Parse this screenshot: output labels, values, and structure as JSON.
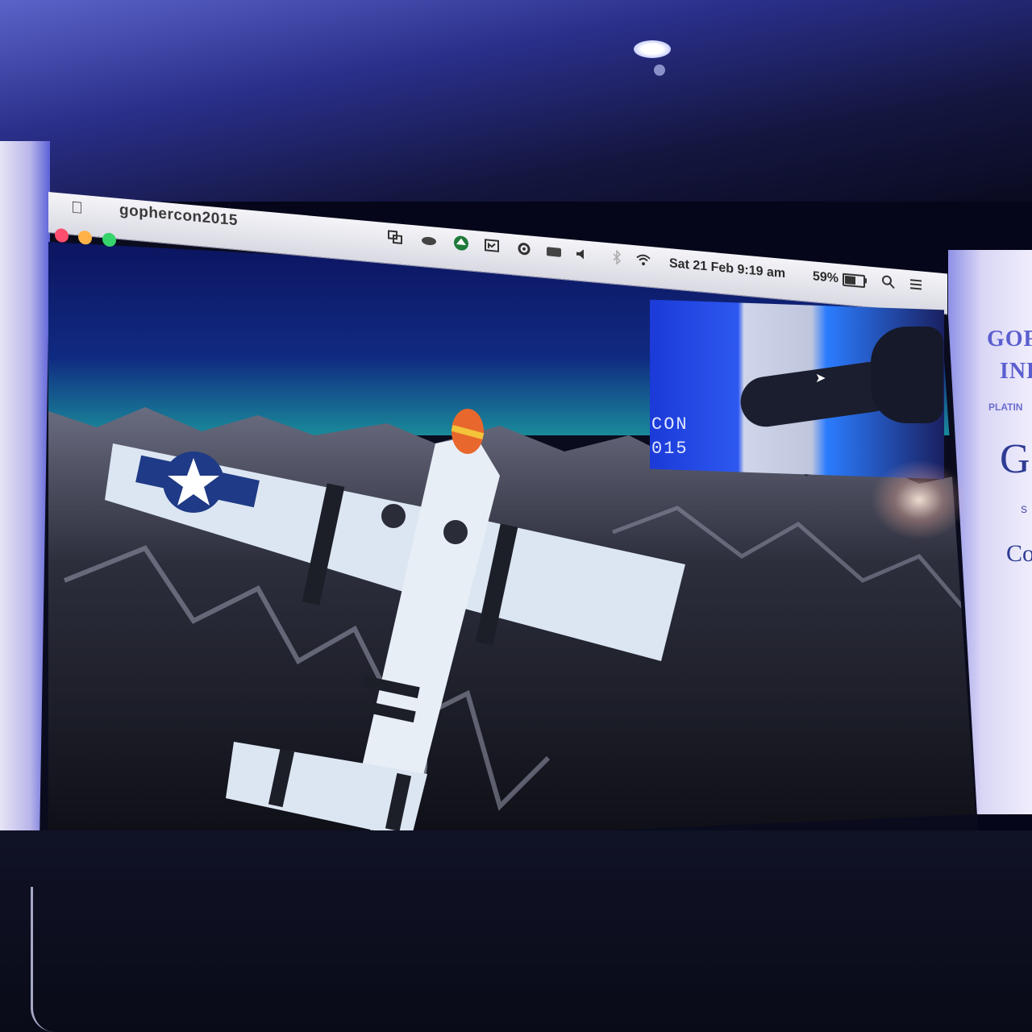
{
  "menubar": {
    "apple_icon": "apple-icon",
    "app_title": "gophercon2015",
    "window_buttons": [
      "close",
      "minimize",
      "zoom"
    ],
    "status_icons": [
      "screen-share-icon",
      "cloud-icon",
      "upload-icon",
      "display-icon",
      "gear-icon",
      "keyboard-icon",
      "volume-icon",
      "bluetooth-icon",
      "wifi-icon"
    ],
    "clock": "Sat 21 Feb  9:19 am",
    "battery": "59%",
    "battery_level": 0.59,
    "right_icons": [
      "search-icon",
      "list-icon"
    ]
  },
  "webcam": {
    "overlay_text_line1": "CON",
    "overlay_text_line2": "015"
  },
  "banner_right": {
    "line1": "GOF",
    "line2": "IND",
    "line3": "PLATIN",
    "line4": "G",
    "line5": "S",
    "line6": "Co"
  },
  "colors": {
    "menubar": "#e6e6ee",
    "sky": "#0d1a70",
    "horizon": "#1a8a9a",
    "mountains": "#2a2c3a",
    "wing": "#dce6f2",
    "roundel": "#1f3a86",
    "stage_light": "#3f46d6"
  }
}
